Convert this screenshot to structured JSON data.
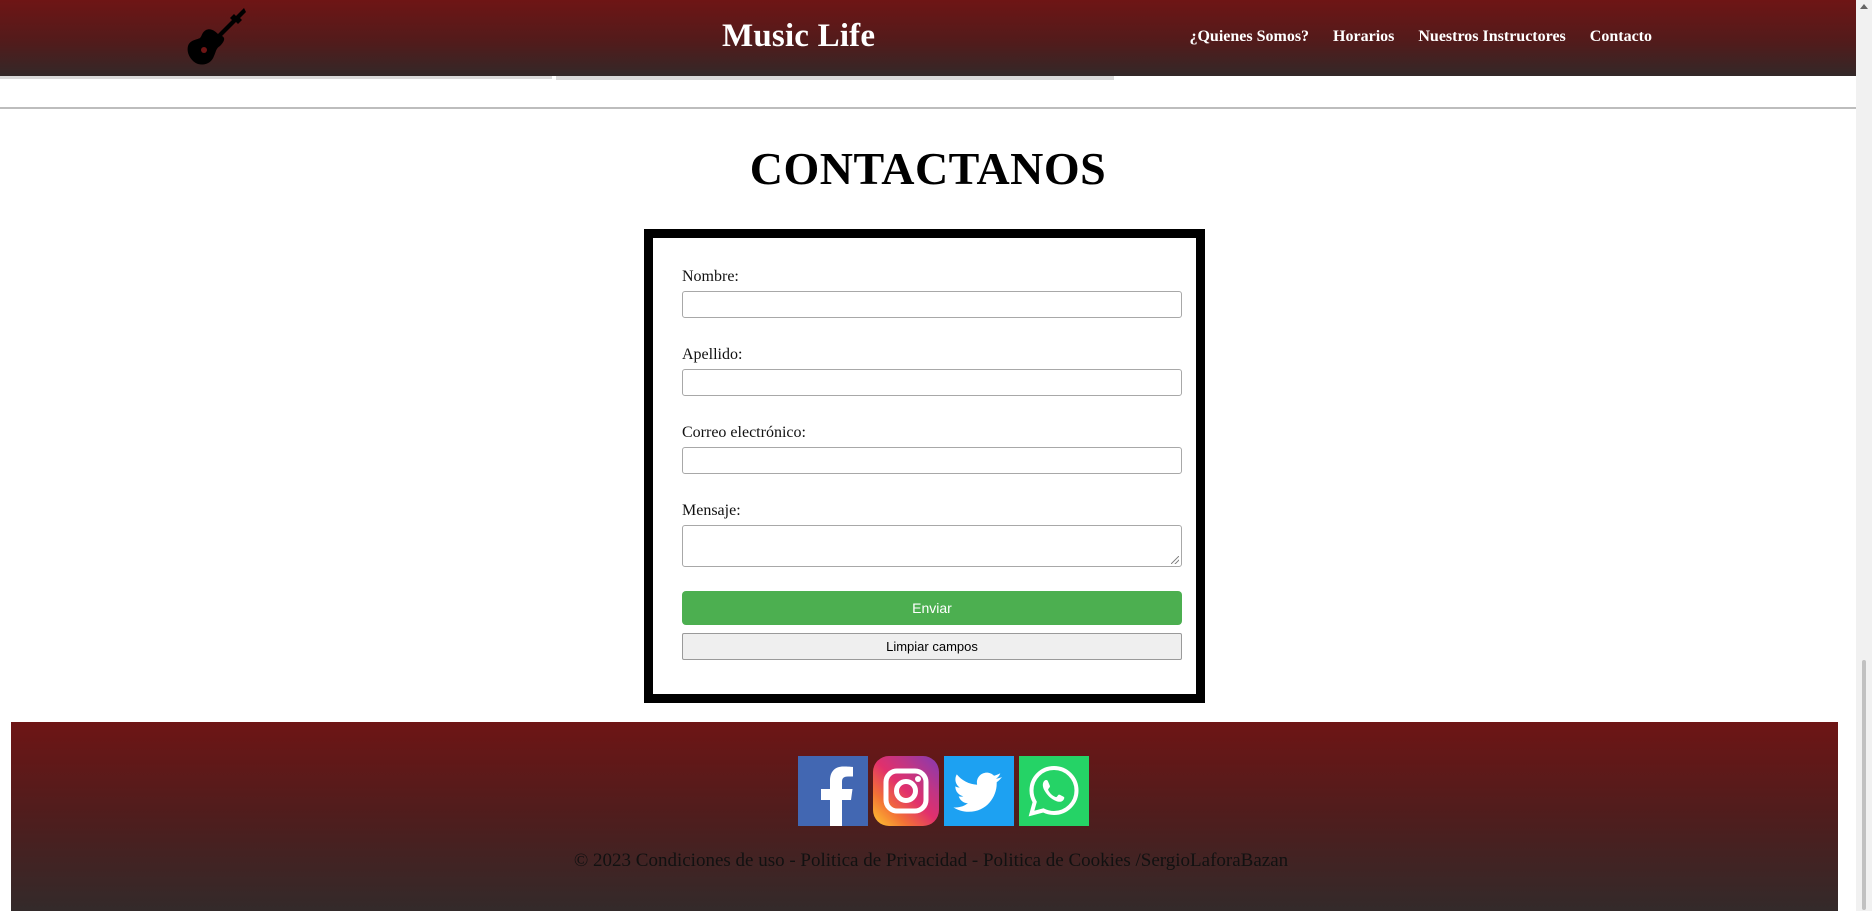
{
  "header": {
    "site_title": "Music Life",
    "logo_icon": "guitar-icon",
    "nav": [
      {
        "label": "¿Quienes Somos?"
      },
      {
        "label": "Horarios"
      },
      {
        "label": "Nuestros Instructores"
      },
      {
        "label": "Contacto"
      }
    ]
  },
  "contact": {
    "title": "CONTACTANOS",
    "fields": {
      "nombre": {
        "label": "Nombre:",
        "value": ""
      },
      "apellido": {
        "label": "Apellido:",
        "value": ""
      },
      "correo": {
        "label": "Correo electrónico:",
        "value": ""
      },
      "mensaje": {
        "label": "Mensaje:",
        "value": ""
      }
    },
    "submit_label": "Enviar",
    "clear_label": "Limpiar campos"
  },
  "footer": {
    "social": [
      {
        "name": "facebook-icon",
        "color": "#4267b2"
      },
      {
        "name": "instagram-icon",
        "color": "#c13584"
      },
      {
        "name": "twitter-icon",
        "color": "#1da1f2"
      },
      {
        "name": "whatsapp-icon",
        "color": "#25d366"
      }
    ],
    "text": "© 2023 Condiciones de uso - Politica de Privacidad - Politica de Cookies /SergioLaforaBazan"
  },
  "colors": {
    "header_top": "#6e1515",
    "header_bottom": "#332828",
    "accent_green": "#4caf50"
  }
}
